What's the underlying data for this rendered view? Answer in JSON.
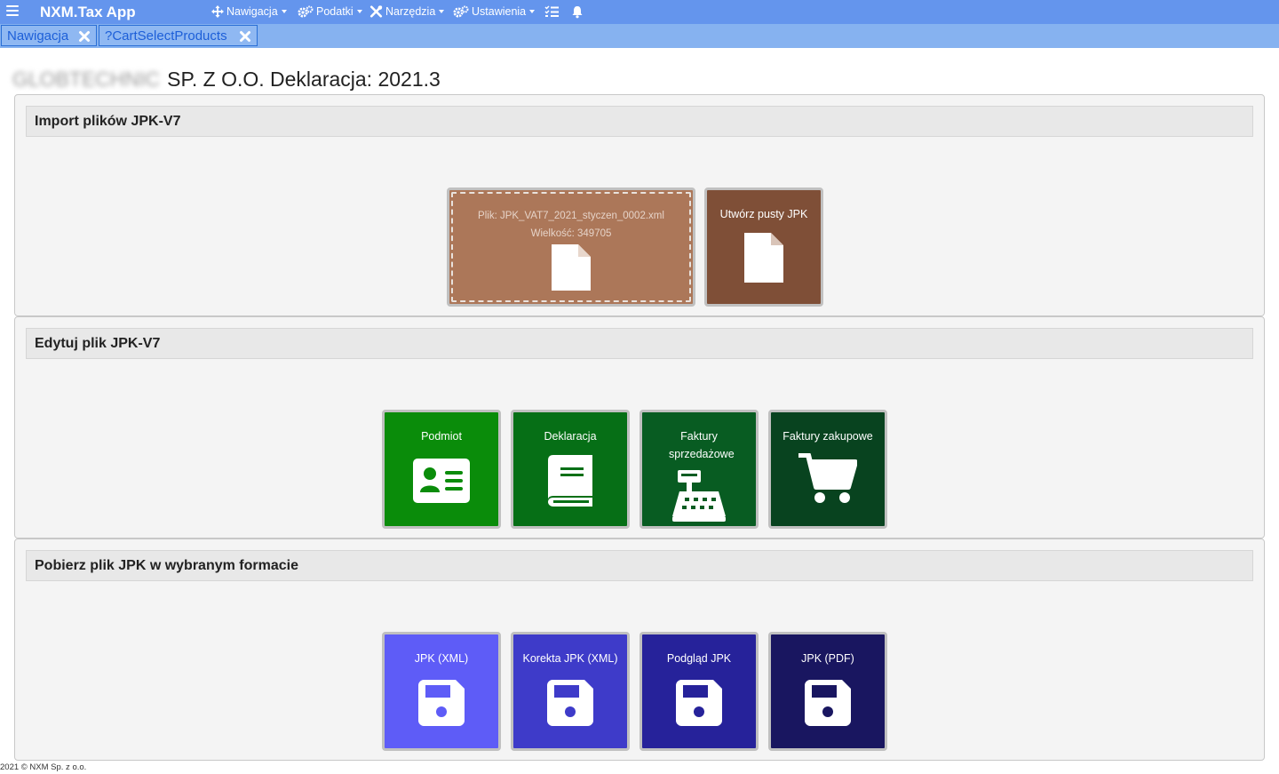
{
  "navbar": {
    "brand": "NXM.Tax App",
    "menus": [
      {
        "label": "Nawigacja",
        "icon": "arrows-move-icon"
      },
      {
        "label": "Podatki",
        "icon": "cogs-icon"
      },
      {
        "label": "Narzędzia",
        "icon": "tools-icon"
      },
      {
        "label": "Ustawienia",
        "icon": "cogs-icon"
      }
    ],
    "icons": [
      "hamburger-icon",
      "tasks-icon",
      "bell-icon"
    ],
    "color": "#6495ed"
  },
  "tabs": [
    {
      "label": "Nawigacja"
    },
    {
      "label": "?CartSelectProducts"
    }
  ],
  "page": {
    "company_blurred": "GLOBTECHNIC",
    "title": "SP. Z O.O. Deklaracja: 2021.3"
  },
  "import_panel": {
    "heading": "Import plików JPK-V7",
    "dropzone": {
      "file": "Plik: JPK_VAT7_2021_styczen_0002.xml",
      "size": "Wielkość: 349705",
      "color": "#ac7759"
    },
    "create_empty": {
      "label": "Utwórz pusty JPK",
      "color": "#7f4f37"
    }
  },
  "edit_panel": {
    "heading": "Edytuj plik JPK-V7",
    "tiles": [
      {
        "label": "Podmiot",
        "icon": "id-card-icon",
        "color": "#0a8c0a"
      },
      {
        "label": "Deklaracja",
        "icon": "book-icon",
        "color": "#066f16"
      },
      {
        "label": "Faktury sprzedażowe",
        "icon": "cash-register-icon",
        "color": "#085c22"
      },
      {
        "label": "Faktury zakupowe",
        "icon": "cart-icon",
        "color": "#08431f"
      }
    ]
  },
  "download_panel": {
    "heading": "Pobierz plik JPK w wybranym formacie",
    "tiles": [
      {
        "label": "JPK (XML)",
        "icon": "save-icon",
        "color": "#5e5cf7"
      },
      {
        "label": "Korekta JPK (XML)",
        "icon": "save-icon",
        "color": "#3e3bc9"
      },
      {
        "label": "Podgląd JPK",
        "icon": "save-icon",
        "color": "#26229a"
      },
      {
        "label": "JPK (PDF)",
        "icon": "save-icon",
        "color": "#191660"
      }
    ]
  },
  "footer": {
    "text": "2021 © NXM Sp. z o.o."
  }
}
